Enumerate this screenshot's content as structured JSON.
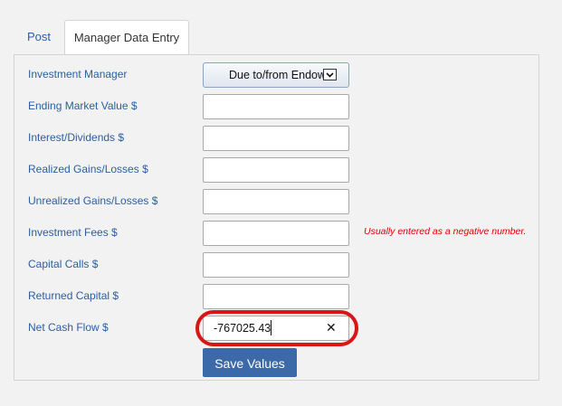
{
  "tabs": [
    {
      "label": "Post"
    },
    {
      "label": "Manager Data Entry"
    }
  ],
  "form": {
    "investment_manager": {
      "label": "Investment Manager",
      "selected": "Due to/from Endowment"
    },
    "ending_market_value": {
      "label": "Ending Market Value $",
      "value": ""
    },
    "interest_dividends": {
      "label": "Interest/Dividends $",
      "value": ""
    },
    "realized_gains": {
      "label": "Realized Gains/Losses $",
      "value": ""
    },
    "unrealized_gains": {
      "label": "Unrealized Gains/Losses $",
      "value": ""
    },
    "investment_fees": {
      "label": "Investment Fees $",
      "value": "",
      "hint": "Usually entered as a negative number."
    },
    "capital_calls": {
      "label": "Capital Calls $",
      "value": ""
    },
    "returned_capital": {
      "label": "Returned Capital $",
      "value": ""
    },
    "net_cash_flow": {
      "label": "Net Cash Flow $",
      "value": "-767025.43",
      "clear_glyph": "✕"
    }
  },
  "save_button": {
    "label": "Save Values"
  },
  "colors": {
    "accent": "#3c6aa9",
    "label": "#2b5ea0",
    "highlight": "#d91515",
    "hint": "#dd0000"
  }
}
